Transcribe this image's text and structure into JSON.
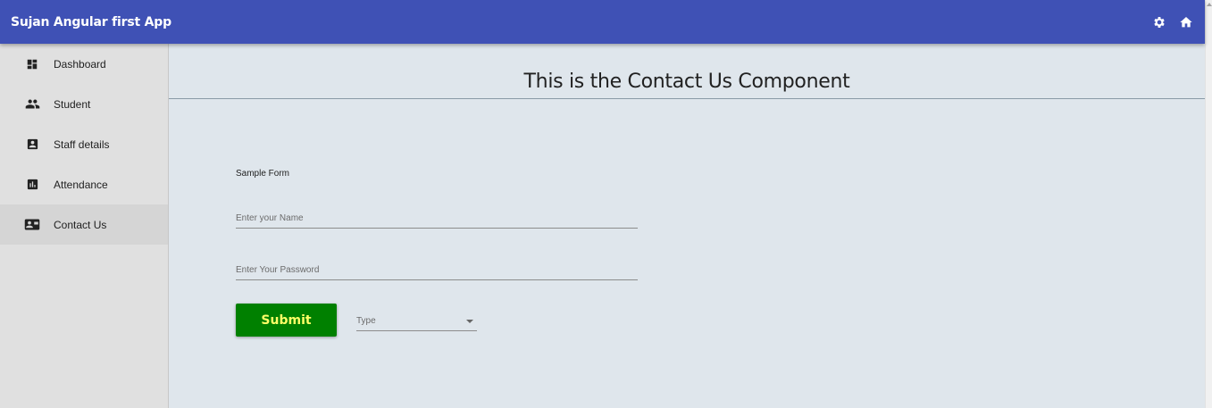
{
  "app": {
    "title": "Sujan Angular first App"
  },
  "toolbar": {
    "icons": [
      "settings-icon",
      "home-icon"
    ]
  },
  "sidebar": {
    "items": [
      {
        "label": "Dashboard",
        "icon": "dashboard-icon",
        "active": false
      },
      {
        "label": "Student",
        "icon": "people-icon",
        "active": false
      },
      {
        "label": "Staff details",
        "icon": "contact-box-icon",
        "active": false
      },
      {
        "label": "Attendance",
        "icon": "bar-chart-icon",
        "active": false
      },
      {
        "label": "Contact Us",
        "icon": "contact-card-icon",
        "active": true
      }
    ]
  },
  "main": {
    "heading": "This is the Contact Us Component",
    "form": {
      "label": "Sample Form",
      "name_placeholder": "Enter your Name",
      "password_placeholder": "Enter Your Password",
      "submit_label": "Submit",
      "type_placeholder": "Type"
    }
  },
  "colors": {
    "toolbar": "#3f51b5",
    "submit_bg": "#008000",
    "submit_text": "#ffff66",
    "content_bg": "#dfe6ec",
    "sidebar_bg": "#e0e0e0"
  }
}
